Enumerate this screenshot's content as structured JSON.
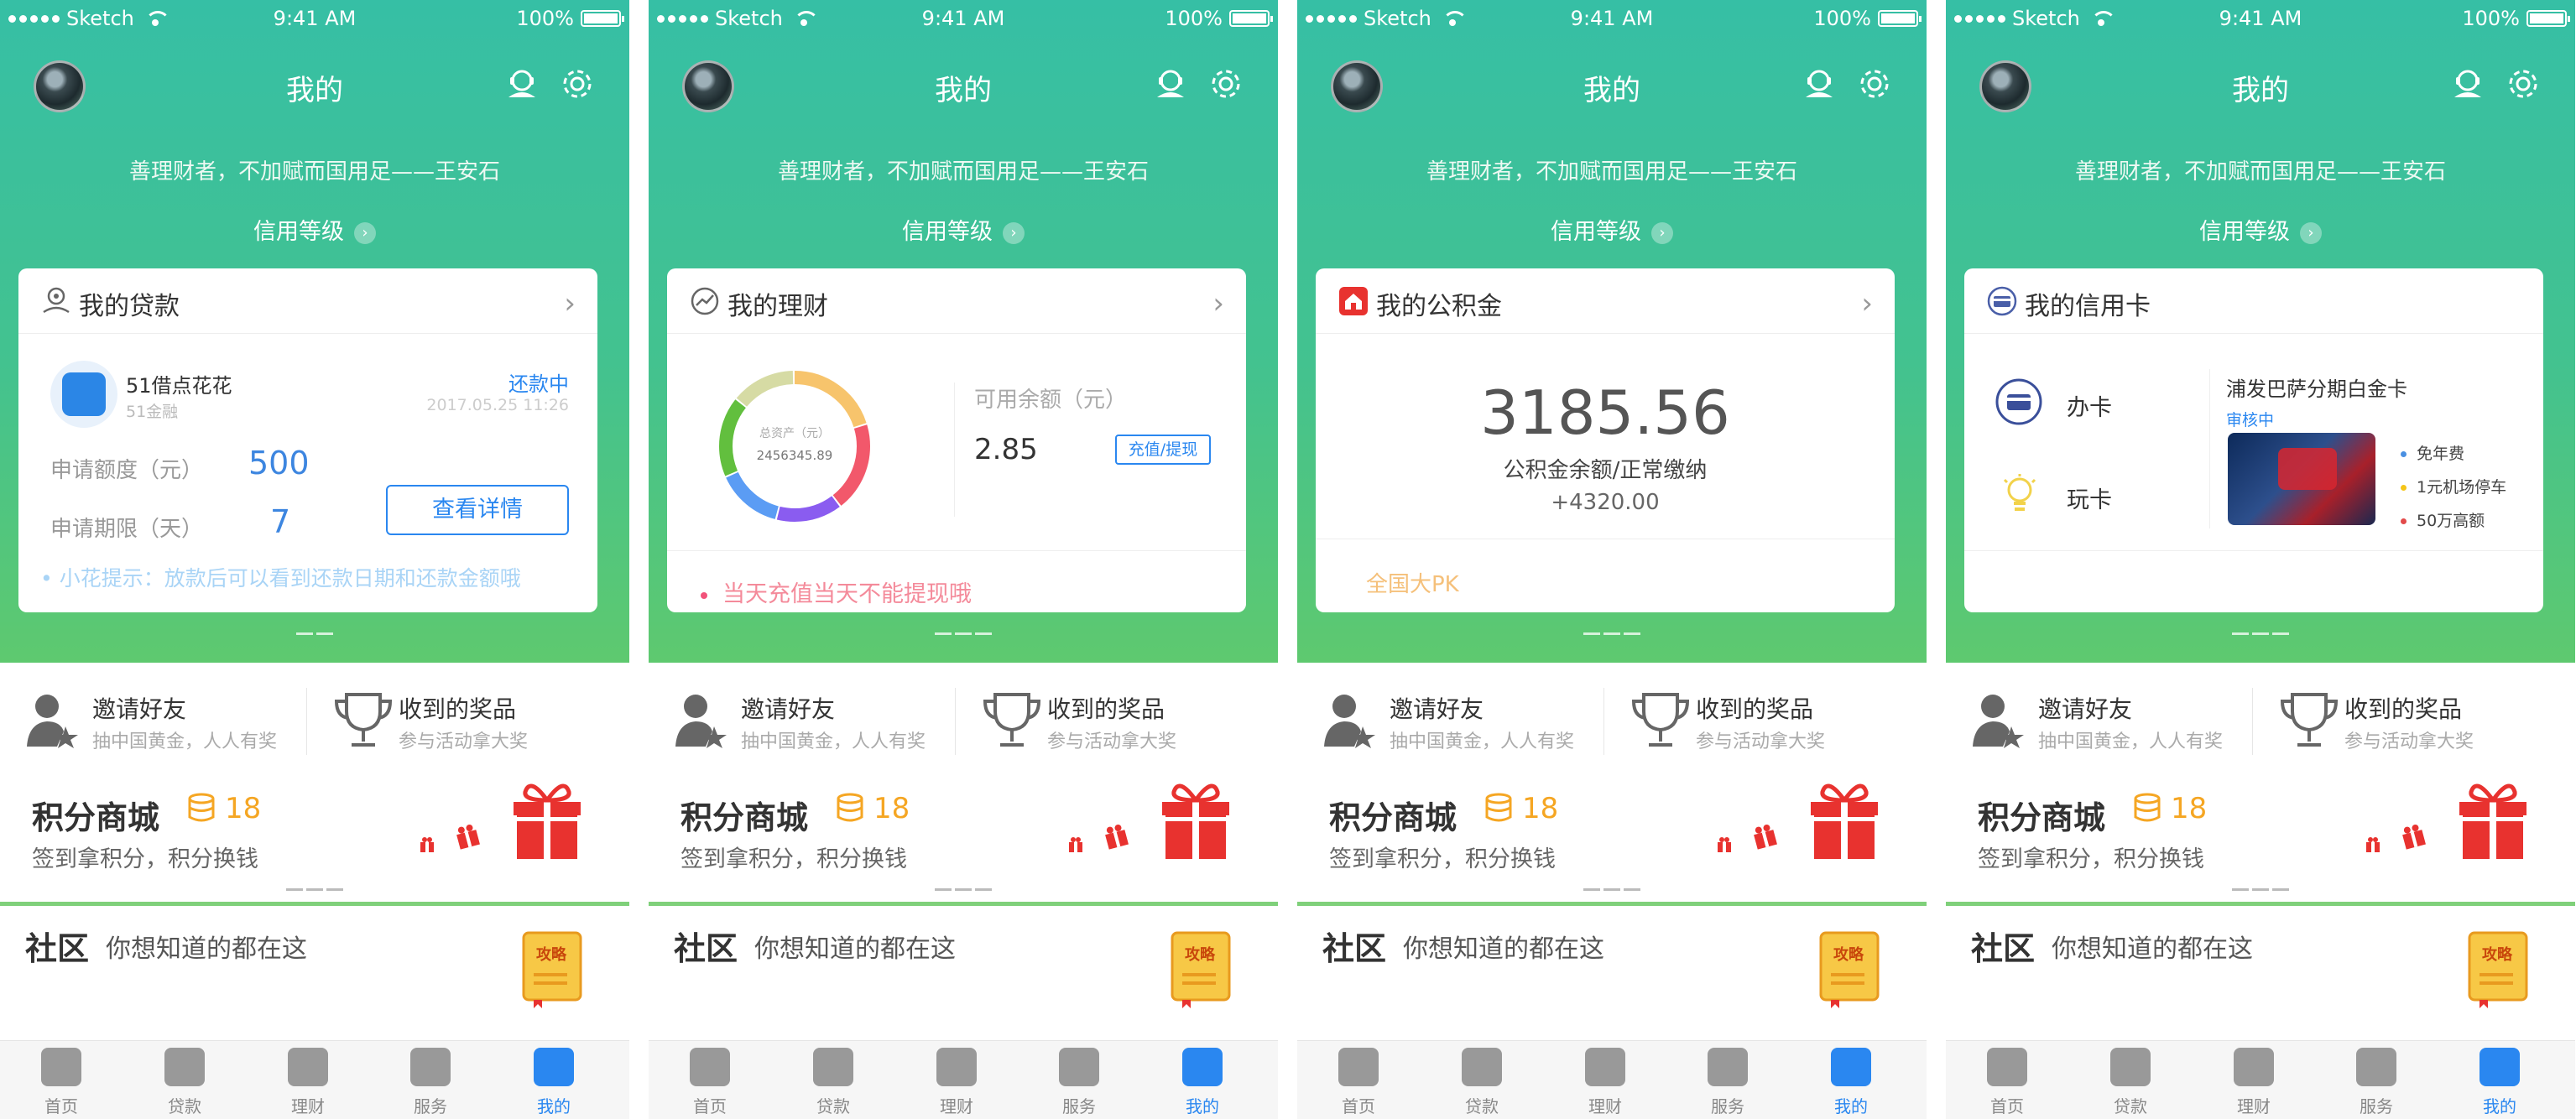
{
  "status": {
    "carrier": "Sketch",
    "time": "9:41 AM",
    "battery": "100%"
  },
  "header": {
    "title": "我的",
    "motto": "善理财者，不加赋而国用足——王安石",
    "credit_label": "信用等级"
  },
  "cards": {
    "loan": {
      "title": "我的贷款",
      "name": "51借点花花",
      "sub": "51金融",
      "status": "还款中",
      "date": "2017.05.25 11:26",
      "amount_label": "申请额度（元）",
      "amount": "500",
      "term_label": "申请期限（天）",
      "term": "7",
      "button": "查看详情",
      "tip": "• 小花提示：放款后可以看到还款日期和还款金额哦"
    },
    "wealth": {
      "title": "我的理财",
      "total_label": "总资产（元）",
      "total": "2456345.89",
      "avail_label": "可用余额（元）",
      "avail": "2.85",
      "button": "充值/提现",
      "tip": "当天充值当天不能提现哦"
    },
    "fund": {
      "title": "我的公积金",
      "amount": "3185.56",
      "label": "公积金余额/正常缴纳",
      "delta": "+4320.00",
      "pk": "全国大PK"
    },
    "credit": {
      "title": "我的信用卡",
      "apply": "办卡",
      "play": "玩卡",
      "card_name": "浦发巴萨分期白金卡",
      "card_status": "审核中",
      "benefits": [
        "免年费",
        "1元机场停车",
        "50万高额"
      ]
    }
  },
  "lower": {
    "invite_title": "邀请好友",
    "invite_sub": "抽中国黄金，人人有奖",
    "prize_title": "收到的奖品",
    "prize_sub": "参与活动拿大奖",
    "mall_title": "积分商城",
    "mall_points": "18",
    "mall_sub": "签到拿积分，积分换钱",
    "community_title": "社区",
    "community_sub": "你想知道的都在这",
    "book_label": "攻略"
  },
  "tabs": [
    "首页",
    "贷款",
    "理财",
    "服务",
    "我的"
  ],
  "colors": {
    "accent": "#2a87f0",
    "hero_top": "#36bfa5",
    "hero_bottom": "#5ec96f",
    "coin": "#f5a623",
    "gift": "#e8322f"
  }
}
